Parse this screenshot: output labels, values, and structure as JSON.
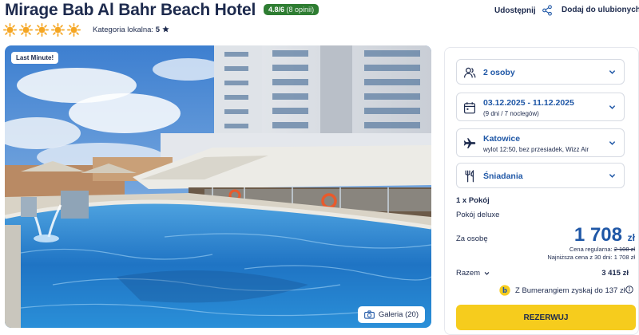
{
  "hotel": {
    "name": "Mirage Bab Al Bahr Beach Hotel",
    "rating": "4.8/6",
    "reviews": "(8 opinii)",
    "star_count": 5,
    "local_category_label": "Kategoria lokalna:",
    "local_category_value": "5"
  },
  "actions": {
    "share_label": "Udostępnij",
    "favorite_label": "Dodaj do ulubionych"
  },
  "photo": {
    "badge": "Last Minute!",
    "gallery_label": "Galeria (20)"
  },
  "booking": {
    "guests": "2 osoby",
    "dates": "03.12.2025 - 11.12.2025",
    "dates_sub": "(9 dni / 7 noclegów)",
    "departure_city": "Katowice",
    "flight_info": "wylot 12:50, bez przesiadek, Wizz Air",
    "board": "Śniadania",
    "room_count": "1 x Pokój",
    "room_type": "Pokój deluxe",
    "per_person_label": "Za osobę",
    "price": "1 708",
    "currency": "zł",
    "regular_label": "Cena regularna:",
    "regular_price": "2 108 zł",
    "lowest_price_text": "Najniższa cena z 30 dni: 1 708 zł",
    "total_label": "Razem",
    "total_value": "3 415 zł",
    "bumerang_text": "Z Bumerangiem zyskaj do 137 zł",
    "reserve_label": "REZERWUJ"
  },
  "colors": {
    "brand_blue": "#1f57a6",
    "rating_green": "#2e7d32",
    "reserve_yellow": "#f6cc1d",
    "star_orange": "#f5a623",
    "text_navy": "#1d2a4d"
  }
}
